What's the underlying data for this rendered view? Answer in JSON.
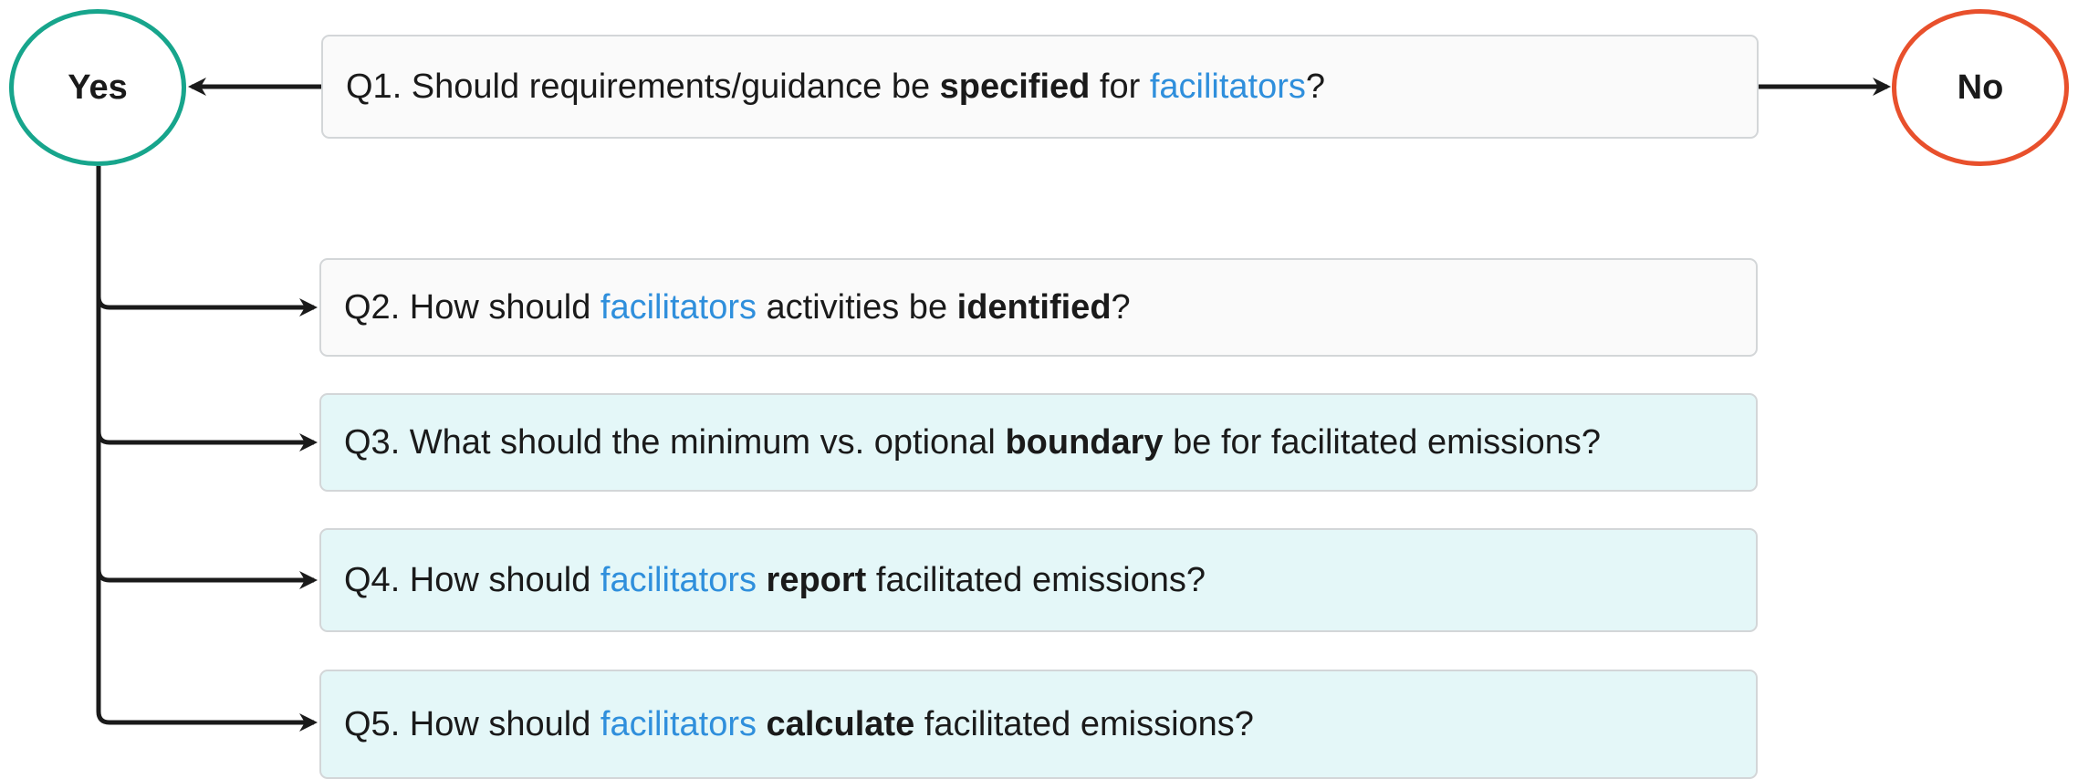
{
  "nodes": {
    "yes": "Yes",
    "no": "No"
  },
  "questions": [
    {
      "number": "Q1.",
      "parts": [
        " Should requirements/guidance be ",
        "specified",
        " for ",
        "facilitators",
        "?"
      ]
    },
    {
      "number": "Q2.",
      "parts": [
        " How should ",
        "facilitators",
        " activities be ",
        "identified",
        "?"
      ]
    },
    {
      "number": "Q3.",
      "parts": [
        " What should the minimum vs. optional ",
        "boundary",
        " be for facilitated emissions?"
      ]
    },
    {
      "number": "Q4.",
      "parts": [
        " How should ",
        "facilitators",
        " ",
        "report",
        " facilitated emissions?"
      ]
    },
    {
      "number": "Q5.",
      "parts": [
        " How should ",
        "facilitators",
        " ",
        "calculate",
        " facilitated emissions?"
      ]
    }
  ],
  "colors": {
    "yes_border": "#17a58c",
    "no_border": "#e8502c",
    "highlight_text": "#2f8fdc",
    "box_white": "#fafafa",
    "box_teal": "#e4f7f8",
    "arrow": "#1a1a1a"
  }
}
